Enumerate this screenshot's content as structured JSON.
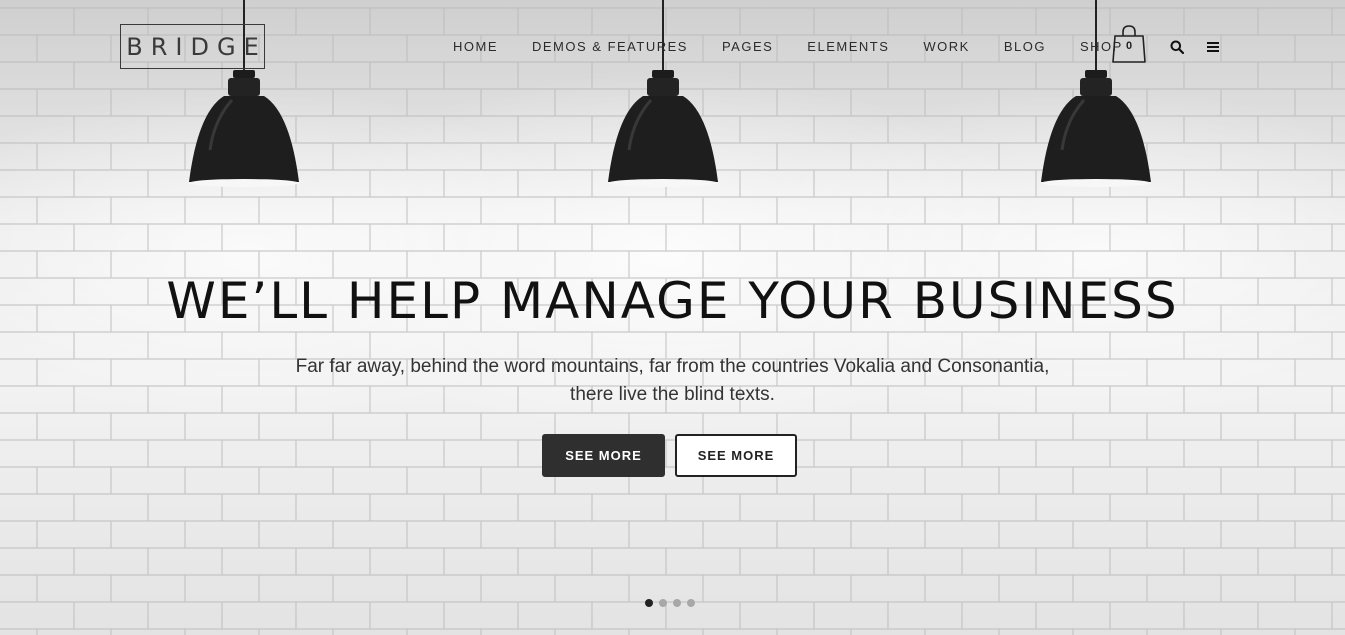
{
  "header": {
    "logo_text": "BRIDGE",
    "nav": [
      {
        "label": "HOME"
      },
      {
        "label": "DEMOS & FEATURES"
      },
      {
        "label": "PAGES"
      },
      {
        "label": "ELEMENTS"
      },
      {
        "label": "WORK"
      },
      {
        "label": "BLOG"
      },
      {
        "label": "SHOP"
      }
    ],
    "cart_count": "0",
    "icons": {
      "cart": "shopping-bag-icon",
      "search": "search-icon",
      "menu": "hamburger-menu-icon"
    }
  },
  "hero": {
    "headline": "WE’LL HELP MANAGE YOUR BUSINESS",
    "subtext_line1": "Far far away, behind the word mountains, far from the countries Vokalia and Consonantia,",
    "subtext_line2": "there live the blind texts.",
    "primary_button": "SEE MORE",
    "secondary_button": "SEE MORE"
  },
  "slider": {
    "slide_count": 4,
    "active_slide": 1
  },
  "colors": {
    "text_dark": "#111111",
    "button_dark": "#2f2f2f",
    "wall": "#e6e6e6"
  }
}
